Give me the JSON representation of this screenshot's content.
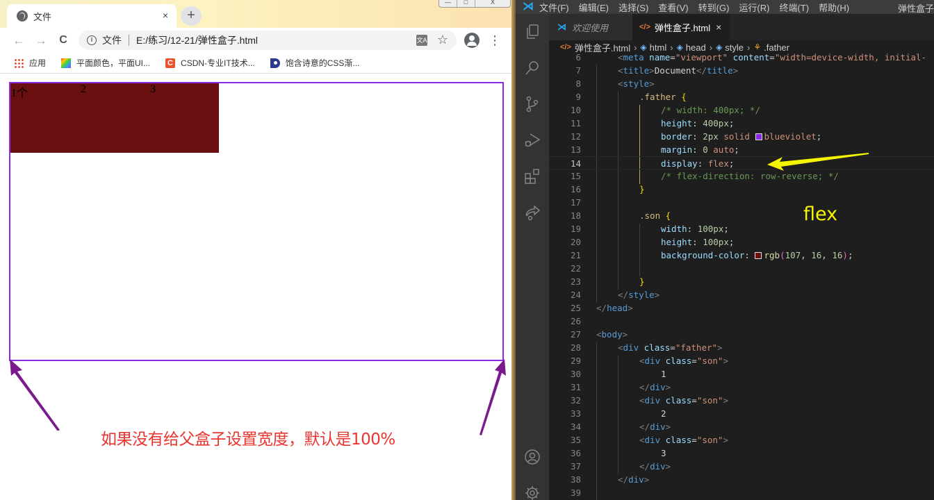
{
  "browser": {
    "tab_title": "文件",
    "tab_close": "×",
    "new_tab": "+",
    "window_controls": [
      "—",
      "□",
      "X"
    ],
    "nav": {
      "back": "←",
      "forward": "→",
      "reload": "C"
    },
    "address": {
      "info_icon": "i",
      "scheme_label": "文件",
      "url": "E:/练习/12-21/弹性盒子.html",
      "translate_icon": "文A",
      "star_icon": "☆"
    },
    "kebab": "⋮",
    "bookmarks": [
      {
        "label": "应用",
        "icon": "apps-icon"
      },
      {
        "label": "平面颜色，平面UI...",
        "icon": "palette-icon"
      },
      {
        "label": "CSDN-专业IT技术...",
        "icon": "csdn-icon",
        "glyph": "C"
      },
      {
        "label": "饱含诗意的CSS渐...",
        "icon": "css-icon"
      }
    ]
  },
  "page": {
    "father_border_color": "#8a2be2",
    "son_color": "#6b1010",
    "sons": [
      {
        "text": "1个"
      },
      {
        "text": "2"
      },
      {
        "text": "3"
      }
    ],
    "annotation": "如果没有给父盒子设置宽度，默认是100%",
    "annotation_color": "#e8352f",
    "arrow_color": "#7b1a8c"
  },
  "vscode": {
    "menu": [
      "文件(F)",
      "编辑(E)",
      "选择(S)",
      "查看(V)",
      "转到(G)",
      "运行(R)",
      "终端(T)",
      "帮助(H)"
    ],
    "window_title": "弹性盒子",
    "tabs": [
      {
        "label": "欢迎使用",
        "active": false
      },
      {
        "label": "弹性盒子.html",
        "active": true,
        "close": "×"
      }
    ],
    "breadcrumb": [
      "弹性盒子.html",
      "html",
      "head",
      "style",
      ".father"
    ],
    "current_line": 14,
    "lines": [
      {
        "n": "6",
        "tokens": [
          [
            "t-br",
            "<"
          ],
          [
            "t-tag",
            "meta"
          ],
          [
            "t-txt",
            " "
          ],
          [
            "t-attr",
            "name"
          ],
          [
            "t-txt",
            "="
          ],
          [
            "t-str",
            "\"viewport\""
          ],
          [
            "t-txt",
            " "
          ],
          [
            "t-attr",
            "content"
          ],
          [
            "t-txt",
            "="
          ],
          [
            "t-str",
            "\"width=device-width, initial-"
          ]
        ],
        "indent": 1
      },
      {
        "n": "7",
        "tokens": [
          [
            "t-br",
            "<"
          ],
          [
            "t-tag",
            "title"
          ],
          [
            "t-br",
            ">"
          ],
          [
            "t-txt",
            "Document"
          ],
          [
            "t-br",
            "</"
          ],
          [
            "t-tag",
            "title"
          ],
          [
            "t-br",
            ">"
          ]
        ],
        "indent": 1
      },
      {
        "n": "8",
        "tokens": [
          [
            "t-br",
            "<"
          ],
          [
            "t-tag",
            "style"
          ],
          [
            "t-br",
            ">"
          ]
        ],
        "indent": 1
      },
      {
        "n": "9",
        "tokens": [
          [
            "t-sel",
            ".father"
          ],
          [
            "t-txt",
            " "
          ],
          [
            "t-brace",
            "{"
          ]
        ],
        "indent": 2
      },
      {
        "n": "10",
        "tokens": [
          [
            "t-com",
            "/* width: 400px; */"
          ]
        ],
        "indent": 3
      },
      {
        "n": "11",
        "tokens": [
          [
            "t-prop",
            "height"
          ],
          [
            "t-txt",
            ": "
          ],
          [
            "t-num",
            "400px"
          ],
          [
            "t-txt",
            ";"
          ]
        ],
        "indent": 3
      },
      {
        "n": "12",
        "tokens": [
          [
            "t-prop",
            "border"
          ],
          [
            "t-txt",
            ": "
          ],
          [
            "t-num",
            "2px"
          ],
          [
            "t-txt",
            " "
          ],
          [
            "t-val",
            "solid"
          ],
          [
            "t-txt",
            " "
          ],
          [
            "swatch",
            "#8a2be2"
          ],
          [
            "t-val",
            "blueviolet"
          ],
          [
            "t-txt",
            ";"
          ]
        ],
        "indent": 3
      },
      {
        "n": "13",
        "tokens": [
          [
            "t-prop",
            "margin"
          ],
          [
            "t-txt",
            ": "
          ],
          [
            "t-num",
            "0"
          ],
          [
            "t-txt",
            " "
          ],
          [
            "t-val",
            "auto"
          ],
          [
            "t-txt",
            ";"
          ]
        ],
        "indent": 3
      },
      {
        "n": "14",
        "tokens": [
          [
            "t-prop",
            "display"
          ],
          [
            "t-txt",
            ": "
          ],
          [
            "t-val",
            "flex"
          ],
          [
            "t-txt",
            ";"
          ]
        ],
        "indent": 3
      },
      {
        "n": "15",
        "tokens": [
          [
            "t-com",
            "/* flex-direction: row-reverse; */"
          ]
        ],
        "indent": 3
      },
      {
        "n": "16",
        "tokens": [
          [
            "t-brace",
            "}"
          ]
        ],
        "indent": 2
      },
      {
        "n": "17",
        "tokens": [],
        "indent": 0
      },
      {
        "n": "18",
        "tokens": [
          [
            "t-sel",
            ".son"
          ],
          [
            "t-txt",
            " "
          ],
          [
            "t-brace",
            "{"
          ]
        ],
        "indent": 2
      },
      {
        "n": "19",
        "tokens": [
          [
            "t-prop",
            "width"
          ],
          [
            "t-txt",
            ": "
          ],
          [
            "t-num",
            "100px"
          ],
          [
            "t-txt",
            ";"
          ]
        ],
        "indent": 3
      },
      {
        "n": "20",
        "tokens": [
          [
            "t-prop",
            "height"
          ],
          [
            "t-txt",
            ": "
          ],
          [
            "t-num",
            "100px"
          ],
          [
            "t-txt",
            ";"
          ]
        ],
        "indent": 3
      },
      {
        "n": "21",
        "tokens": [
          [
            "t-prop",
            "background-color"
          ],
          [
            "t-txt",
            ": "
          ],
          [
            "swatch",
            "#6b1010"
          ],
          [
            "t-fn",
            "rgb"
          ],
          [
            "t-paren",
            "("
          ],
          [
            "t-num",
            "107"
          ],
          [
            "t-txt",
            ", "
          ],
          [
            "t-num",
            "16"
          ],
          [
            "t-txt",
            ", "
          ],
          [
            "t-num",
            "16"
          ],
          [
            "t-paren",
            ")"
          ],
          [
            "t-txt",
            ";"
          ]
        ],
        "indent": 3
      },
      {
        "n": "22",
        "tokens": [],
        "indent": 0
      },
      {
        "n": "23",
        "tokens": [
          [
            "t-brace",
            "}"
          ]
        ],
        "indent": 2
      },
      {
        "n": "24",
        "tokens": [
          [
            "t-br",
            "</"
          ],
          [
            "t-tag",
            "style"
          ],
          [
            "t-br",
            ">"
          ]
        ],
        "indent": 1
      },
      {
        "n": "25",
        "tokens": [
          [
            "t-br",
            "</"
          ],
          [
            "t-tag",
            "head"
          ],
          [
            "t-br",
            ">"
          ]
        ],
        "indent": 0
      },
      {
        "n": "26",
        "tokens": [],
        "indent": 0
      },
      {
        "n": "27",
        "tokens": [
          [
            "t-br",
            "<"
          ],
          [
            "t-tag",
            "body"
          ],
          [
            "t-br",
            ">"
          ]
        ],
        "indent": 0
      },
      {
        "n": "28",
        "tokens": [
          [
            "t-br",
            "<"
          ],
          [
            "t-tag",
            "div"
          ],
          [
            "t-txt",
            " "
          ],
          [
            "t-attr",
            "class"
          ],
          [
            "t-txt",
            "="
          ],
          [
            "t-str",
            "\"father\""
          ],
          [
            "t-br",
            ">"
          ]
        ],
        "indent": 1
      },
      {
        "n": "29",
        "tokens": [
          [
            "t-br",
            "<"
          ],
          [
            "t-tag",
            "div"
          ],
          [
            "t-txt",
            " "
          ],
          [
            "t-attr",
            "class"
          ],
          [
            "t-txt",
            "="
          ],
          [
            "t-str",
            "\"son\""
          ],
          [
            "t-br",
            ">"
          ]
        ],
        "indent": 2
      },
      {
        "n": "30",
        "tokens": [
          [
            "t-txt",
            "1"
          ]
        ],
        "indent": 3
      },
      {
        "n": "31",
        "tokens": [
          [
            "t-br",
            "</"
          ],
          [
            "t-tag",
            "div"
          ],
          [
            "t-br",
            ">"
          ]
        ],
        "indent": 2
      },
      {
        "n": "32",
        "tokens": [
          [
            "t-br",
            "<"
          ],
          [
            "t-tag",
            "div"
          ],
          [
            "t-txt",
            " "
          ],
          [
            "t-attr",
            "class"
          ],
          [
            "t-txt",
            "="
          ],
          [
            "t-str",
            "\"son\""
          ],
          [
            "t-br",
            ">"
          ]
        ],
        "indent": 2
      },
      {
        "n": "33",
        "tokens": [
          [
            "t-txt",
            "2"
          ]
        ],
        "indent": 3
      },
      {
        "n": "34",
        "tokens": [
          [
            "t-br",
            "</"
          ],
          [
            "t-tag",
            "div"
          ],
          [
            "t-br",
            ">"
          ]
        ],
        "indent": 2
      },
      {
        "n": "35",
        "tokens": [
          [
            "t-br",
            "<"
          ],
          [
            "t-tag",
            "div"
          ],
          [
            "t-txt",
            " "
          ],
          [
            "t-attr",
            "class"
          ],
          [
            "t-txt",
            "="
          ],
          [
            "t-str",
            "\"son\""
          ],
          [
            "t-br",
            ">"
          ]
        ],
        "indent": 2
      },
      {
        "n": "36",
        "tokens": [
          [
            "t-txt",
            "3"
          ]
        ],
        "indent": 3
      },
      {
        "n": "37",
        "tokens": [
          [
            "t-br",
            "</"
          ],
          [
            "t-tag",
            "div"
          ],
          [
            "t-br",
            ">"
          ]
        ],
        "indent": 2
      },
      {
        "n": "38",
        "tokens": [
          [
            "t-br",
            "</"
          ],
          [
            "t-tag",
            "div"
          ],
          [
            "t-br",
            ">"
          ]
        ],
        "indent": 1
      },
      {
        "n": "39",
        "tokens": [],
        "indent": 0
      }
    ],
    "annotation": "flex",
    "annotation_color": "#f5f500"
  }
}
